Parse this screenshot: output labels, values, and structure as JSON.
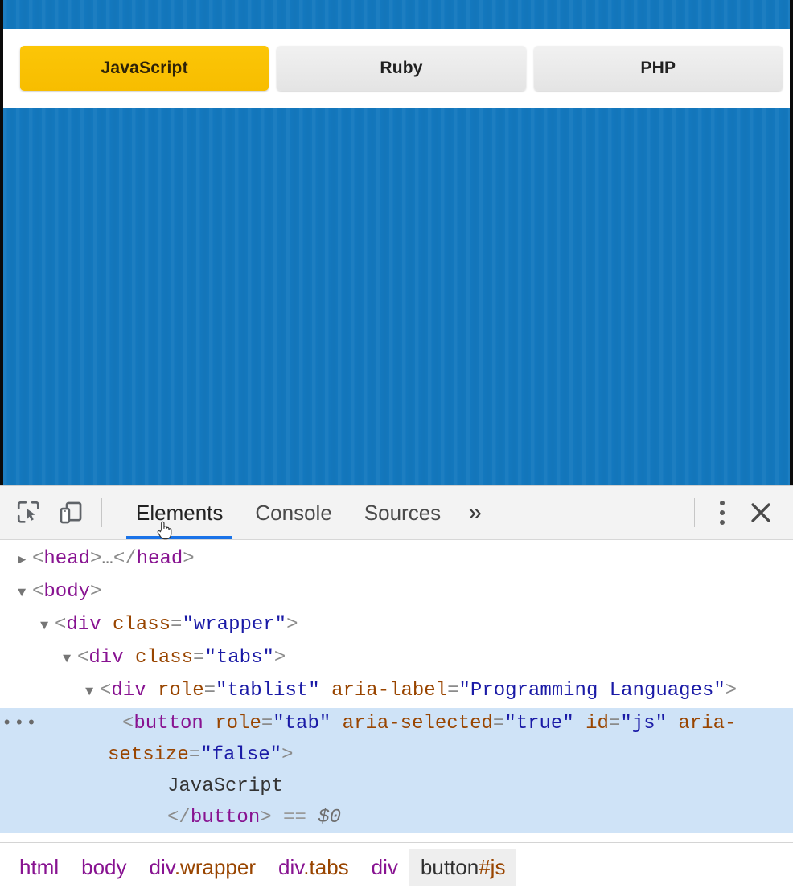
{
  "page": {
    "background_color": "#1378be",
    "tabs": {
      "aria_label": "Programming Languages",
      "items": [
        {
          "label": "JavaScript",
          "id": "js",
          "selected": true,
          "color": "#f9c000"
        },
        {
          "label": "Ruby",
          "id": "rb",
          "selected": false,
          "color": "#e8e8e8"
        },
        {
          "label": "PHP",
          "id": "php",
          "selected": false,
          "color": "#e8e8e8"
        }
      ]
    }
  },
  "devtools": {
    "toolbar": {
      "inspect_icon": "inspect-element-icon",
      "device_icon": "device-toolbar-icon",
      "tabs": [
        {
          "label": "Elements",
          "active": true
        },
        {
          "label": "Console",
          "active": false
        },
        {
          "label": "Sources",
          "active": false
        }
      ],
      "more_tabs_label": "»",
      "menu_icon": "kebab-menu-icon",
      "close_icon": "close-icon"
    },
    "dom_tree": {
      "rows": [
        {
          "arrow": "▶",
          "indent": 0,
          "selected": false,
          "parts": [
            {
              "t": "punct",
              "s": "<"
            },
            {
              "t": "tag",
              "s": "head"
            },
            {
              "t": "punct",
              "s": ">"
            },
            {
              "t": "dots",
              "s": "…"
            },
            {
              "t": "punct",
              "s": "</"
            },
            {
              "t": "tag",
              "s": "head"
            },
            {
              "t": "punct",
              "s": ">"
            }
          ]
        },
        {
          "arrow": "▼",
          "indent": 0,
          "selected": false,
          "parts": [
            {
              "t": "punct",
              "s": "<"
            },
            {
              "t": "tag",
              "s": "body"
            },
            {
              "t": "punct",
              "s": ">"
            }
          ]
        },
        {
          "arrow": "▼",
          "indent": 1,
          "selected": false,
          "parts": [
            {
              "t": "punct",
              "s": "<"
            },
            {
              "t": "tag",
              "s": "div"
            },
            {
              "t": "txt",
              "s": " "
            },
            {
              "t": "attr",
              "s": "class"
            },
            {
              "t": "punct",
              "s": "="
            },
            {
              "t": "val",
              "s": "\"wrapper\""
            },
            {
              "t": "punct",
              "s": ">"
            }
          ]
        },
        {
          "arrow": "▼",
          "indent": 2,
          "selected": false,
          "parts": [
            {
              "t": "punct",
              "s": "<"
            },
            {
              "t": "tag",
              "s": "div"
            },
            {
              "t": "txt",
              "s": " "
            },
            {
              "t": "attr",
              "s": "class"
            },
            {
              "t": "punct",
              "s": "="
            },
            {
              "t": "val",
              "s": "\"tabs\""
            },
            {
              "t": "punct",
              "s": ">"
            }
          ]
        },
        {
          "arrow": "▼",
          "indent": 3,
          "selected": false,
          "parts": [
            {
              "t": "punct",
              "s": "<"
            },
            {
              "t": "tag",
              "s": "div"
            },
            {
              "t": "txt",
              "s": " "
            },
            {
              "t": "attr",
              "s": "role"
            },
            {
              "t": "punct",
              "s": "="
            },
            {
              "t": "val",
              "s": "\"tablist\""
            },
            {
              "t": "txt",
              "s": " "
            },
            {
              "t": "attr",
              "s": "aria-label"
            },
            {
              "t": "punct",
              "s": "="
            },
            {
              "t": "val",
              "s": "\"Programming Languages\""
            },
            {
              "t": "punct",
              "s": ">"
            }
          ]
        },
        {
          "arrow": "",
          "indent": 4,
          "selected": true,
          "ellipsis": "•••",
          "parts": [
            {
              "t": "punct",
              "s": "<"
            },
            {
              "t": "tag",
              "s": "button"
            },
            {
              "t": "txt",
              "s": " "
            },
            {
              "t": "attr",
              "s": "role"
            },
            {
              "t": "punct",
              "s": "="
            },
            {
              "t": "val",
              "s": "\"tab\""
            },
            {
              "t": "txt",
              "s": " "
            },
            {
              "t": "attr",
              "s": "aria-selected"
            },
            {
              "t": "punct",
              "s": "="
            },
            {
              "t": "val",
              "s": "\"true\""
            },
            {
              "t": "txt",
              "s": " "
            },
            {
              "t": "attr",
              "s": "id"
            },
            {
              "t": "punct",
              "s": "="
            },
            {
              "t": "val",
              "s": "\"js\""
            },
            {
              "t": "txt",
              "s": " "
            },
            {
              "t": "attr",
              "s": "aria-setsize"
            },
            {
              "t": "punct",
              "s": "="
            },
            {
              "t": "val",
              "s": "\"false\""
            },
            {
              "t": "punct",
              "s": ">"
            }
          ]
        },
        {
          "arrow": "",
          "indent": 6,
          "selected": true,
          "parts": [
            {
              "t": "txt",
              "s": "JavaScript"
            }
          ]
        },
        {
          "arrow": "",
          "indent": 6,
          "selected": true,
          "parts": [
            {
              "t": "punct",
              "s": "</"
            },
            {
              "t": "tag",
              "s": "button"
            },
            {
              "t": "punct",
              "s": ">"
            },
            {
              "t": "txt",
              "s": " "
            },
            {
              "t": "eqeq",
              "s": "=="
            },
            {
              "t": "txt",
              "s": " "
            },
            {
              "t": "dollar",
              "s": "$0"
            }
          ]
        }
      ]
    },
    "breadcrumbs": [
      {
        "tag": "html",
        "cls": "",
        "selected": false
      },
      {
        "tag": "body",
        "cls": "",
        "selected": false
      },
      {
        "tag": "div",
        "cls": ".wrapper",
        "selected": false
      },
      {
        "tag": "div",
        "cls": ".tabs",
        "selected": false
      },
      {
        "tag": "div",
        "cls": "",
        "selected": false
      },
      {
        "tag": "button",
        "cls": "#js",
        "selected": true
      }
    ]
  }
}
